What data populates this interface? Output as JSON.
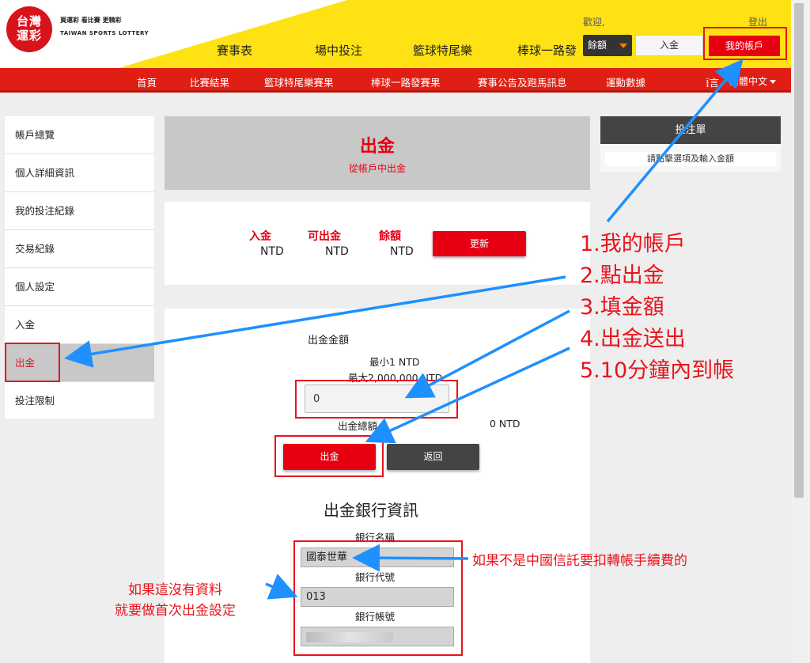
{
  "brand": {
    "logo_text": "台灣\n運彩",
    "slogan": "買運彩  看比賽  更精彩",
    "slogan_en": "TAIWAN SPORTS LOTTERY"
  },
  "main_nav": [
    "賽事表",
    "場中投注",
    "籃球特尾樂",
    "棒球一路發"
  ],
  "header": {
    "welcome": "歡迎,",
    "logout": "登出",
    "balance_select": "餘額",
    "deposit": "入金",
    "my_account": "我的帳戶"
  },
  "sub_nav": [
    "首頁",
    "比賽結果",
    "籃球特尾樂賽果",
    "棒球一路發賽果",
    "賽事公告及跑馬訊息",
    "運動數據"
  ],
  "sub_nav_lang_hidden": "語言",
  "language": "繁體中文",
  "sidebar": {
    "items": [
      "帳戶總覽",
      "個人詳細資訊",
      "我的投注紀錄",
      "交易紀錄",
      "個人設定",
      "入金",
      "出金",
      "投注限制"
    ],
    "active_index": 6
  },
  "panel": {
    "title": "出金",
    "subtitle": "從帳戶中出金"
  },
  "balances": {
    "labels": [
      "入金",
      "可出金",
      "餘額"
    ],
    "values": [
      "NTD",
      "NTD",
      "NTD"
    ],
    "refresh": "更新"
  },
  "form": {
    "amount_label": "出金金額",
    "min": "最小1 NTD",
    "max": "最大2,000,000 NTD",
    "amount_value": "0",
    "total_label": "出金總額",
    "total_value": "0 NTD",
    "submit": "出金",
    "back": "返回"
  },
  "bank": {
    "heading": "出金銀行資訊",
    "name_label": "銀行名稱",
    "name_value": "國泰世華",
    "code_label": "銀行代號",
    "code_value": "013",
    "account_label": "銀行帳號"
  },
  "betslip": {
    "title": "投注單",
    "message": "請點擊選項及輸入金額"
  },
  "annotations": {
    "steps": [
      "1.我的帳戶",
      "2.點出金",
      "3.填金額",
      "4.出金送出",
      "5.10分鐘內到帳"
    ],
    "left_note": [
      "如果這沒有資料",
      "就要做首次出金設定"
    ],
    "right_note": "如果不是中國信託要扣轉帳手續費的"
  },
  "colors": {
    "brand_red": "#e60012",
    "header_yellow": "#ffe214",
    "annotation_red": "#e8141c",
    "arrow_blue": "#1e90ff"
  }
}
